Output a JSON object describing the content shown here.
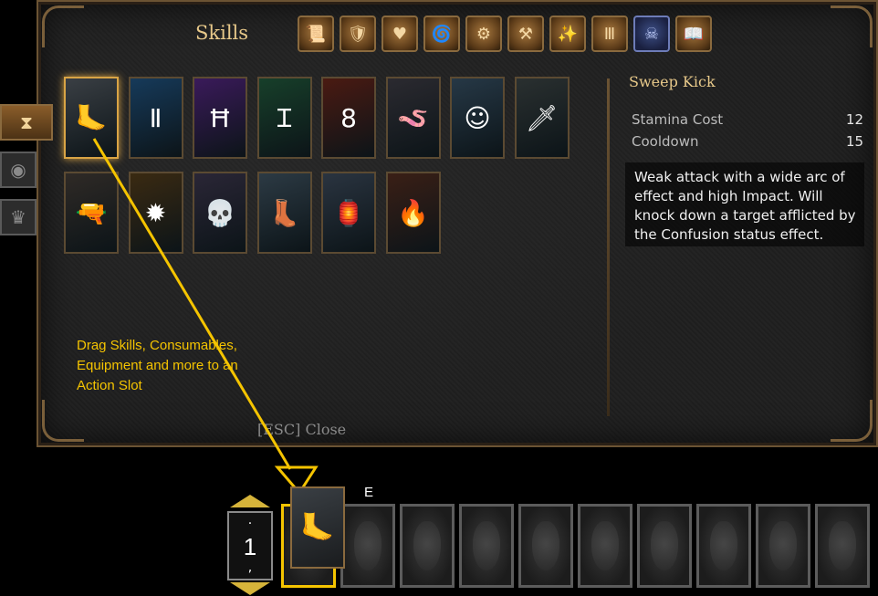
{
  "panel": {
    "title": "Skills",
    "close_hint": "[ESC] Close"
  },
  "tabs": [
    {
      "icon": "scroll-icon",
      "glyph": "📜"
    },
    {
      "icon": "shield-icon",
      "glyph": "🛡"
    },
    {
      "icon": "heart-icon",
      "glyph": "♥"
    },
    {
      "icon": "spiral-icon",
      "glyph": "🌀"
    },
    {
      "icon": "gear-icon",
      "glyph": "⚙"
    },
    {
      "icon": "anvil-icon",
      "glyph": "⚒"
    },
    {
      "icon": "sparkle-icon",
      "glyph": "✨"
    },
    {
      "icon": "roman-numerals-icon",
      "glyph": "Ⅲ"
    },
    {
      "icon": "skull-icon",
      "glyph": "☠"
    },
    {
      "icon": "book-icon",
      "glyph": "📖"
    }
  ],
  "side_tabs": [
    {
      "icon": "hourglass-icon",
      "glyph": "⧗"
    },
    {
      "icon": "circle-icon",
      "glyph": "◉"
    },
    {
      "icon": "crown-icon",
      "glyph": "♛"
    }
  ],
  "skills": [
    {
      "name": "sweep-kick",
      "glyph": "🦶",
      "color": "#3a3f44"
    },
    {
      "name": "rune-ii",
      "glyph": "Ⅱ",
      "color": "#163a5a"
    },
    {
      "name": "rune-h",
      "glyph": "Ħ",
      "color": "#3a1a5a"
    },
    {
      "name": "rune-i",
      "glyph": "Ɪ",
      "color": "#173f2a"
    },
    {
      "name": "rune-8",
      "glyph": "8",
      "color": "#4a1a12"
    },
    {
      "name": "worm",
      "glyph": "🪱",
      "color": "#2b2a30"
    },
    {
      "name": "frost-face",
      "glyph": "☺",
      "color": "#263846"
    },
    {
      "name": "knife",
      "glyph": "🗡",
      "color": "#2a3030"
    },
    {
      "name": "flintlock",
      "glyph": "🔫",
      "color": "#2f2a26"
    },
    {
      "name": "fire-spark",
      "glyph": "✹",
      "color": "#3a2a12"
    },
    {
      "name": "skull-face",
      "glyph": "💀",
      "color": "#2a2636"
    },
    {
      "name": "boot-kick",
      "glyph": "👢",
      "color": "#2c3a44"
    },
    {
      "name": "lantern",
      "glyph": "🏮",
      "color": "#2a3440"
    },
    {
      "name": "fire-face",
      "glyph": "🔥",
      "color": "#3a1f16"
    }
  ],
  "detail": {
    "name": "Sweep Kick",
    "stats": [
      {
        "label": "Stamina Cost",
        "value": "12"
      },
      {
        "label": "Cooldown",
        "value": "15"
      }
    ],
    "description": "Weak attack with a wide arc of effect and high Impact. Will knock down a target afflicted by the Confusion status effect."
  },
  "tooltip": "Drag Skills, Consumables, Equipment and more to an Action Slot",
  "action_bar": {
    "page_number": "1",
    "prev_key": ".",
    "next_key": ",",
    "hotkey": "E",
    "slot_count": 10,
    "highlight_color": "#f5c400"
  }
}
